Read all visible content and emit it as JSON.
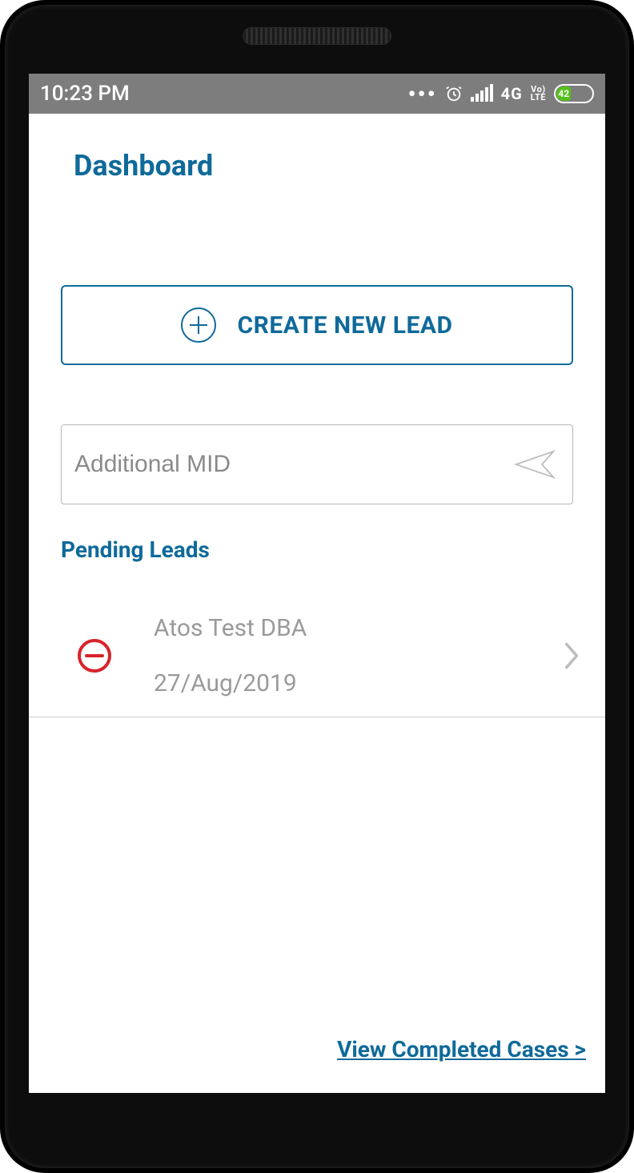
{
  "status_bar": {
    "time": "10:23 PM",
    "network_type": "4G",
    "volte_top": "Vo)",
    "volte_bottom": "LTE",
    "battery_percent": "42"
  },
  "page": {
    "title": "Dashboard"
  },
  "create_lead": {
    "label": "CREATE NEW LEAD"
  },
  "mid_input": {
    "placeholder": "Additional MID",
    "value": ""
  },
  "pending_section": {
    "title": "Pending Leads",
    "leads": [
      {
        "name": "Atos Test DBA",
        "date": "27/Aug/2019"
      }
    ]
  },
  "completed_link": {
    "label": "View Completed Cases >"
  }
}
